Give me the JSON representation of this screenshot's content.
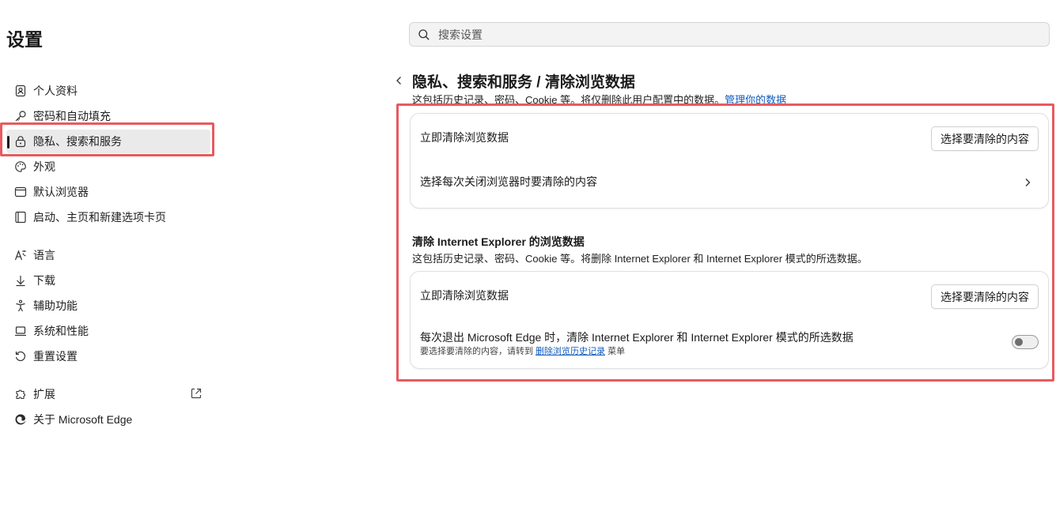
{
  "app": {
    "title": "设置"
  },
  "search": {
    "placeholder": "搜索设置"
  },
  "sidebar": {
    "items": [
      {
        "label": "个人资料",
        "icon": "profile-icon"
      },
      {
        "label": "密码和自动填充",
        "icon": "key-icon"
      },
      {
        "label": "隐私、搜索和服务",
        "icon": "lock-icon",
        "active": true
      },
      {
        "label": "外观",
        "icon": "palette-icon"
      },
      {
        "label": "默认浏览器",
        "icon": "browser-icon"
      },
      {
        "label": "启动、主页和新建选项卡页",
        "icon": "home-icon"
      },
      {
        "label": "语言",
        "icon": "language-icon"
      },
      {
        "label": "下载",
        "icon": "download-icon"
      },
      {
        "label": "辅助功能",
        "icon": "accessibility-icon"
      },
      {
        "label": "系统和性能",
        "icon": "laptop-icon"
      },
      {
        "label": "重置设置",
        "icon": "reset-icon"
      },
      {
        "label": "扩展",
        "icon": "puzzle-icon",
        "external": true
      },
      {
        "label": "关于 Microsoft Edge",
        "icon": "edge-logo-icon"
      }
    ]
  },
  "main": {
    "title": "隐私、搜索和服务 / 清除浏览数据",
    "desc_text": "这包括历史记录、密码、Cookie 等。将仅删除此用户配置中的数据。",
    "desc_link": "管理你的数据",
    "card1": {
      "row1_label": "立即清除浏览数据",
      "row1_button": "选择要清除的内容",
      "row2_label": "选择每次关闭浏览器时要清除的内容"
    },
    "ie_section": {
      "title": "清除 Internet Explorer 的浏览数据",
      "desc": "这包括历史记录、密码、Cookie 等。将删除 Internet Explorer 和 Internet Explorer 模式的所选数据。"
    },
    "card2": {
      "row1_label": "立即清除浏览数据",
      "row1_button": "选择要清除的内容",
      "row2_label": "每次退出 Microsoft Edge 时，清除 Internet Explorer 和 Internet Explorer 模式的所选数据",
      "row2_note_prefix": "要选择要清除的内容，请转到",
      "row2_note_link": "删除浏览历史记录",
      "row2_note_suffix": "菜单",
      "toggle_on": false
    }
  },
  "colors": {
    "highlight": "#e85a5f",
    "link": "#0f5bbd"
  }
}
